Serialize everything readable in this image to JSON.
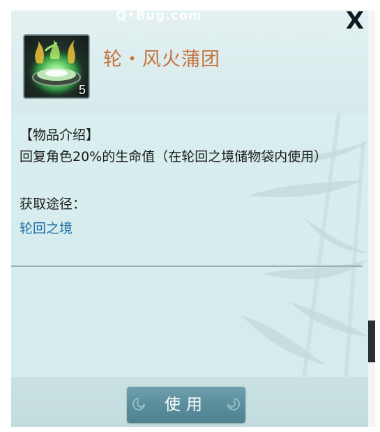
{
  "watermark": "Q•Bug.com",
  "item": {
    "name": "轮・风火蒲团",
    "count": "5"
  },
  "close": {
    "symbol": "X"
  },
  "description": {
    "heading": "【物品介绍】",
    "text": "回复角色20%的生命值（在轮回之境储物袋内使用）"
  },
  "obtain": {
    "label": "获取途径：",
    "source": "轮回之境"
  },
  "actions": {
    "use_label": "使用"
  },
  "colors": {
    "title": "#c3733f",
    "link": "#1f6ea8",
    "button": "#5a8e9c"
  }
}
